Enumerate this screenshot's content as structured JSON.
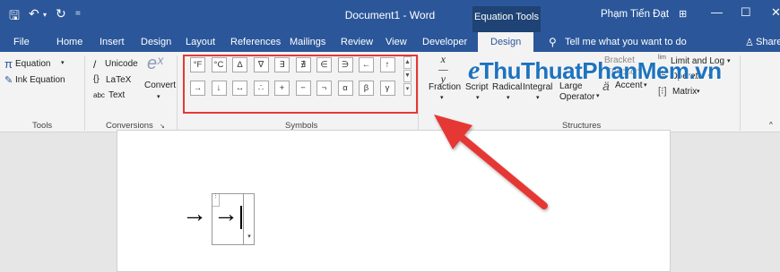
{
  "window": {
    "title": "Document1 - Word",
    "context_tab_group": "Equation Tools",
    "user": "Phạm Tiến Đạt"
  },
  "tabs": [
    "File",
    "Home",
    "Insert",
    "Design",
    "Layout",
    "References",
    "Mailings",
    "Review",
    "View",
    "Developer",
    "Design"
  ],
  "tell_me": "Tell me what you want to do",
  "share": "Share",
  "ribbon": {
    "tools": {
      "equation": "Equation",
      "ink_equation": "Ink Equation",
      "label": "Tools"
    },
    "conversions": {
      "unicode": "Unicode",
      "latex": "LaTeX",
      "text": "Text",
      "abc": "abc",
      "convert": "Convert",
      "label": "Conversions"
    },
    "symbols": {
      "row1": [
        "°F",
        "°C",
        "Δ",
        "∇",
        "∃",
        "∄",
        "∈",
        "∋",
        "←",
        "↑"
      ],
      "row2": [
        "→",
        "↓",
        "↔",
        "∴",
        "+",
        "−",
        "¬",
        "α",
        "β",
        "γ"
      ],
      "label": "Symbols"
    },
    "structures": {
      "fraction": "Fraction",
      "script": "Script",
      "radical": "Radical",
      "integral": "Integral",
      "large_operator": "Large Operator",
      "bracket": "Bracket",
      "function": "Function",
      "accent": "Accent",
      "limit_log": "Limit and Log",
      "operator": "Operator",
      "matrix": "Matrix",
      "label": "Structures"
    }
  },
  "watermark": "ThuThuatPhanMem.vn",
  "equation": {
    "outside": "→",
    "inside": "→"
  }
}
